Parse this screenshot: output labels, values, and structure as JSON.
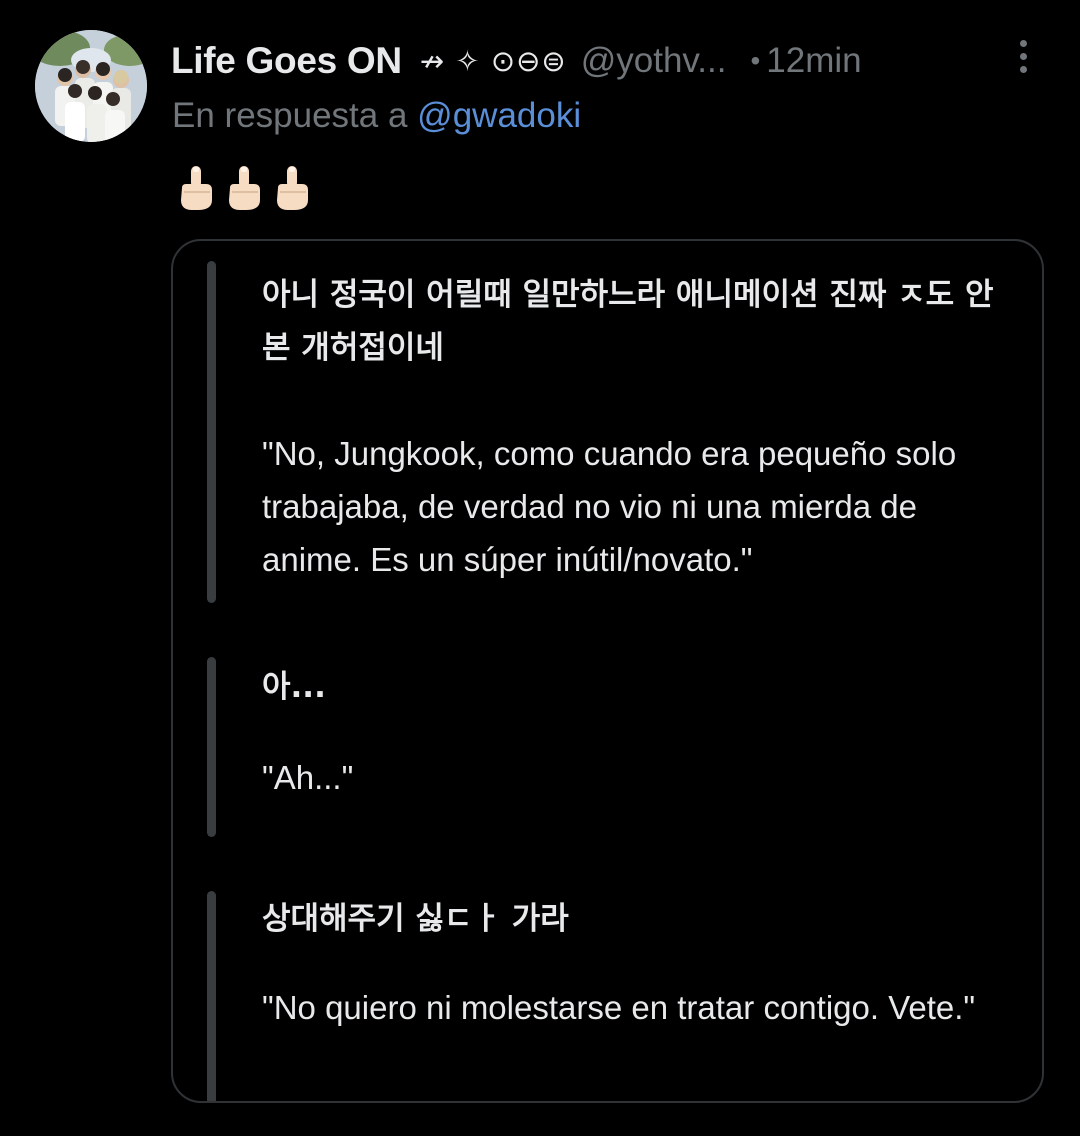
{
  "tweet": {
    "display_name": "Life Goes ON",
    "name_suffix": "↛ ✧ ⊙⊖⊜",
    "handle": "@yothv...",
    "separator": "•",
    "timestamp": "12min",
    "reply_prefix": "En respuesta a",
    "reply_handle": "@gwadoki",
    "emoji_icons": [
      "middle-finger-emoji",
      "middle-finger-emoji",
      "middle-finger-emoji"
    ],
    "link_color": "#5a8fd8"
  },
  "quote": {
    "blocks": [
      {
        "korean": "아니 정국이 어릴때 일만하느라 애니메이션 진짜 ㅈ도 안 본 개허접이네",
        "translation": "\"No, Jungkook, como cuando era pequeño solo trabajaba, de verdad no vio ni una mierda de anime. Es un súper inútil/novato.\""
      },
      {
        "korean": "아...",
        "translation": "\"Ah...\""
      },
      {
        "korean": "상대해주기 싫ㄷㅏ 가라",
        "translation": "\"No quiero ni molestarse en tratar contigo. Vete.\""
      }
    ]
  }
}
